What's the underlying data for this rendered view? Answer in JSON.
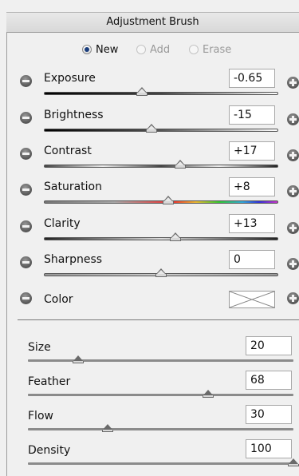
{
  "panel": {
    "title": "Adjustment Brush"
  },
  "modes": [
    {
      "label": "New",
      "selected": true,
      "enabled": true
    },
    {
      "label": "Add",
      "selected": false,
      "enabled": false
    },
    {
      "label": "Erase",
      "selected": false,
      "enabled": false
    }
  ],
  "sliders": [
    {
      "label": "Exposure",
      "value": "-0.65",
      "position": 0.42
    },
    {
      "label": "Brightness",
      "value": "-15",
      "position": 0.46
    },
    {
      "label": "Contrast",
      "value": "+17",
      "position": 0.58
    },
    {
      "label": "Saturation",
      "value": "+8",
      "position": 0.53
    },
    {
      "label": "Clarity",
      "value": "+13",
      "position": 0.56
    },
    {
      "label": "Sharpness",
      "value": "0",
      "position": 0.5
    }
  ],
  "color": {
    "label": "Color"
  },
  "brush": [
    {
      "label": "Size",
      "value": "20",
      "position": 0.19
    },
    {
      "label": "Feather",
      "value": "68",
      "position": 0.68
    },
    {
      "label": "Flow",
      "value": "30",
      "position": 0.3
    },
    {
      "label": "Density",
      "value": "100",
      "position": 1.0
    }
  ]
}
